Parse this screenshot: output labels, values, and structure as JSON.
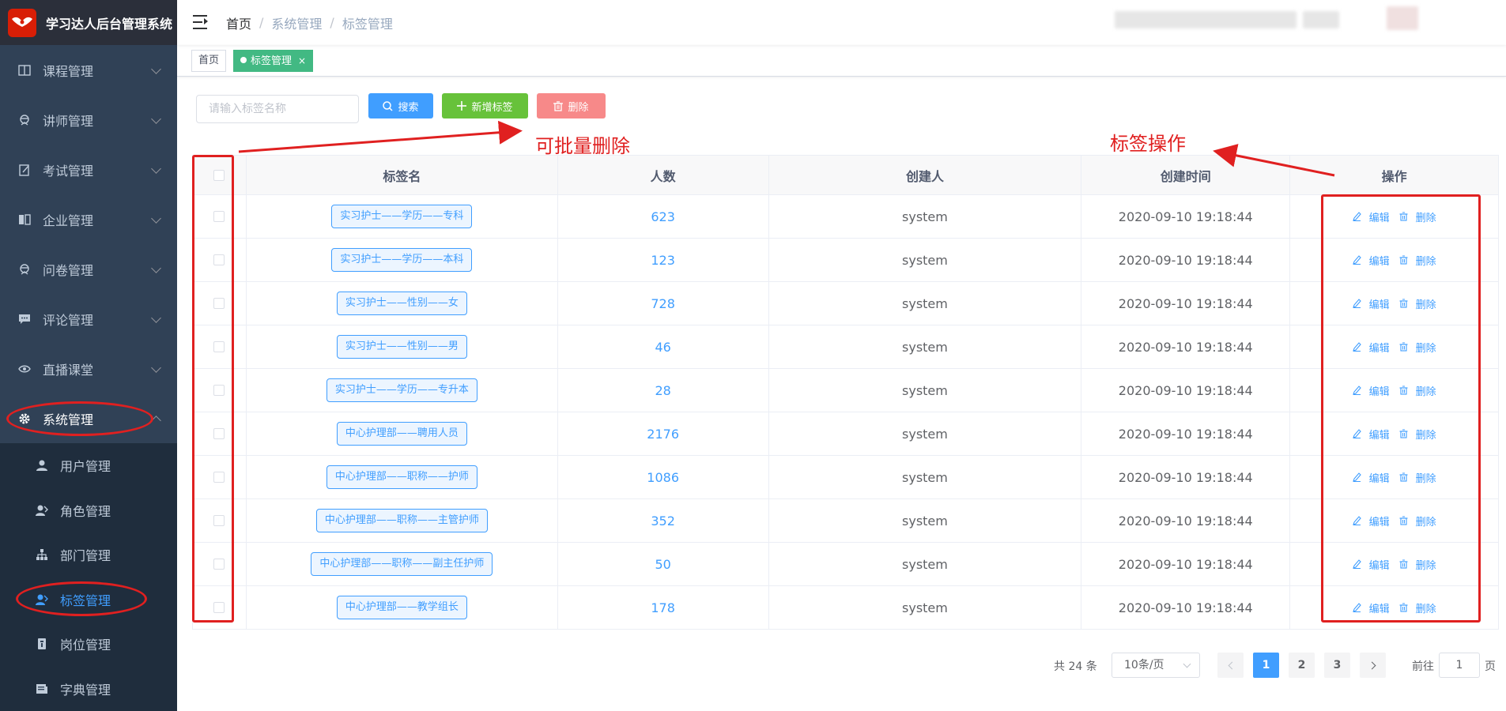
{
  "app": {
    "title": "学习达人后台管理系统"
  },
  "sidebar": {
    "items": [
      {
        "label": "课程管理",
        "icon": "book-icon"
      },
      {
        "label": "讲师管理",
        "icon": "teacher-icon"
      },
      {
        "label": "考试管理",
        "icon": "edit-icon"
      },
      {
        "label": "企业管理",
        "icon": "company-icon"
      },
      {
        "label": "问卷管理",
        "icon": "survey-icon"
      },
      {
        "label": "评论管理",
        "icon": "comment-icon"
      },
      {
        "label": "直播课堂",
        "icon": "eye-icon"
      },
      {
        "label": "系统管理",
        "icon": "gear-icon",
        "expanded": true
      }
    ],
    "sub_items": [
      {
        "label": "用户管理",
        "icon": "user-icon"
      },
      {
        "label": "角色管理",
        "icon": "role-icon"
      },
      {
        "label": "部门管理",
        "icon": "tree-icon"
      },
      {
        "label": "标签管理",
        "icon": "tag-user-icon",
        "active": true
      },
      {
        "label": "岗位管理",
        "icon": "post-icon"
      },
      {
        "label": "字典管理",
        "icon": "dict-icon"
      }
    ]
  },
  "breadcrumb": {
    "home": "首页",
    "parent": "系统管理",
    "current": "标签管理",
    "separator": "/"
  },
  "tags": {
    "home": "首页",
    "active": "标签管理",
    "close": "×"
  },
  "toolbar": {
    "search_placeholder": "请输入标签名称",
    "search_label": "搜索",
    "add_label": "新增标签",
    "delete_label": "删除"
  },
  "annotations": {
    "batch_delete": "可批量删除",
    "tag_ops": "标签操作"
  },
  "table": {
    "headers": {
      "name": "标签名",
      "count": "人数",
      "creator": "创建人",
      "time": "创建时间",
      "ops": "操作"
    },
    "edit_label": "编辑",
    "delete_label": "删除",
    "rows": [
      {
        "name": "实习护士——学历——专科",
        "count": "623",
        "creator": "system",
        "time": "2020-09-10 19:18:44"
      },
      {
        "name": "实习护士——学历——本科",
        "count": "123",
        "creator": "system",
        "time": "2020-09-10 19:18:44"
      },
      {
        "name": "实习护士——性别——女",
        "count": "728",
        "creator": "system",
        "time": "2020-09-10 19:18:44"
      },
      {
        "name": "实习护士——性别——男",
        "count": "46",
        "creator": "system",
        "time": "2020-09-10 19:18:44"
      },
      {
        "name": "实习护士——学历——专升本",
        "count": "28",
        "creator": "system",
        "time": "2020-09-10 19:18:44"
      },
      {
        "name": "中心护理部——聘用人员",
        "count": "2176",
        "creator": "system",
        "time": "2020-09-10 19:18:44"
      },
      {
        "name": "中心护理部——职称——护师",
        "count": "1086",
        "creator": "system",
        "time": "2020-09-10 19:18:44"
      },
      {
        "name": "中心护理部——职称——主管护师",
        "count": "352",
        "creator": "system",
        "time": "2020-09-10 19:18:44"
      },
      {
        "name": "中心护理部——职称——副主任护师",
        "count": "50",
        "creator": "system",
        "time": "2020-09-10 19:18:44"
      },
      {
        "name": "中心护理部——教学组长",
        "count": "178",
        "creator": "system",
        "time": "2020-09-10 19:18:44"
      }
    ]
  },
  "pagination": {
    "total": "共 24 条",
    "page_size": "10条/页",
    "pages": [
      "1",
      "2",
      "3"
    ],
    "current_page": "1",
    "goto_label": "前往",
    "goto_value": "1",
    "goto_unit": "页"
  },
  "colors": {
    "primary": "#409eff",
    "success": "#67c23a",
    "danger": "#f78989",
    "sidebar_bg": "#304156",
    "annotation": "#e02020",
    "active_tag": "#42b983"
  }
}
